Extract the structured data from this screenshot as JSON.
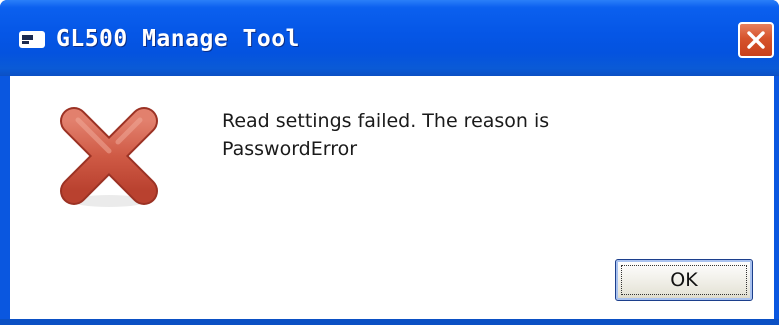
{
  "window": {
    "title": "GL500 Manage Tool",
    "app_icon": "application-icon",
    "close_icon": "close-icon",
    "colors": {
      "titlebar": "#0556e6",
      "close_button": "#d6532c",
      "client_background": "#ffffff"
    }
  },
  "dialog": {
    "icon": "error-x-icon",
    "icon_color": "#c9503d",
    "message_line1": "Read settings failed. The reason is",
    "message_line2": "PasswordError",
    "ok_label": "OK"
  }
}
